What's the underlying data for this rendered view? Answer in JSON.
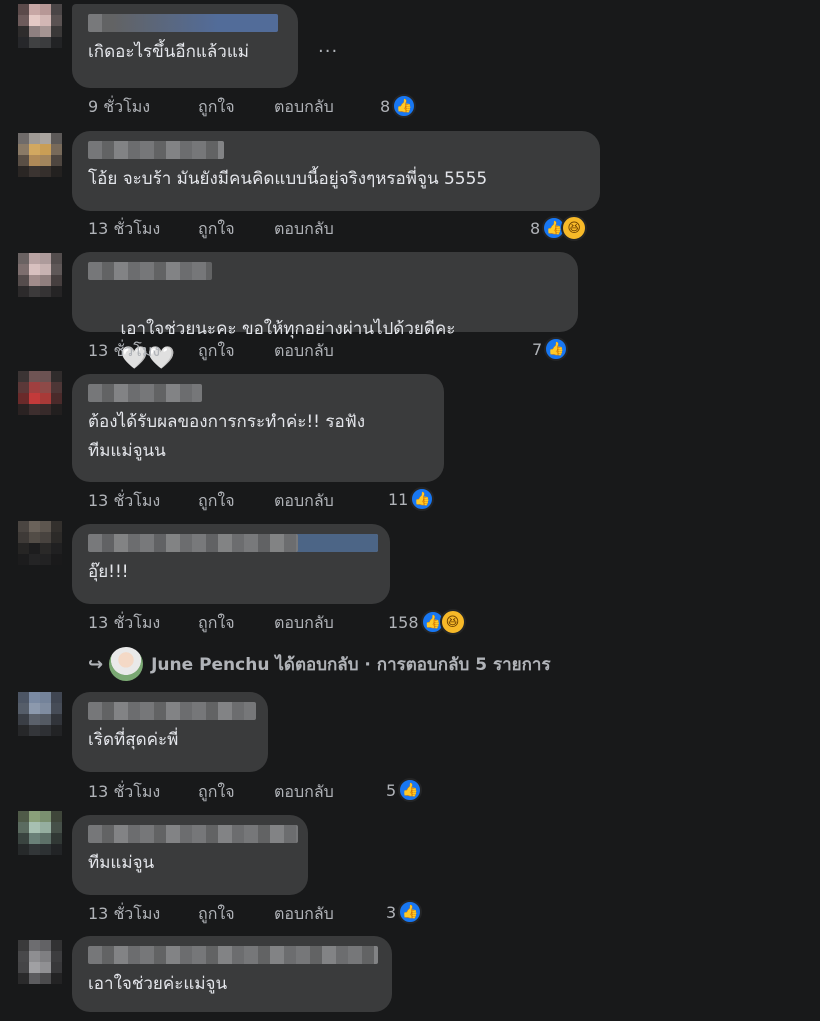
{
  "ui": {
    "more_label": "...",
    "like_glyph": "👍",
    "haha_glyph": "😆"
  },
  "comments": [
    {
      "text": "เกิดอะไรขึ้นอีกแล้วแม่",
      "time": "9 ชั่วโมง",
      "like": "ถูกใจ",
      "reply": "ตอบกลับ",
      "count": "8",
      "reactions": [
        "like"
      ]
    },
    {
      "text": "โอ้ย จะบร้า มันยังมีคนคิดแบบนี้อยู่จริงๆหรอพี่จูน 5555",
      "time": "13 ชั่วโมง",
      "like": "ถูกใจ",
      "reply": "ตอบกลับ",
      "count": "8",
      "reactions": [
        "like",
        "haha"
      ]
    },
    {
      "text": "เอาใจช่วยนะคะ ขอให้ทุกอย่างผ่านไปด้วยดีคะ",
      "hearts": "🤍🤍",
      "time": "13 ชั่วโมง",
      "like": "ถูกใจ",
      "reply": "ตอบกลับ",
      "count": "7",
      "reactions": [
        "like"
      ]
    },
    {
      "text": "ต้องได้รับผลของการกระทำค่ะ!! รอฟัง\nทีมแม่จูนน",
      "time": "13 ชั่วโมง",
      "like": "ถูกใจ",
      "reply": "ตอบกลับ",
      "count": "11",
      "reactions": [
        "like"
      ]
    },
    {
      "text": "อุ๊ย!!!",
      "time": "13 ชั่วโมง",
      "like": "ถูกใจ",
      "reply": "ตอบกลับ",
      "count": "158",
      "reactions": [
        "like",
        "haha"
      ]
    },
    {
      "text": "เริ่ดที่สุดค่ะพี่",
      "time": "13 ชั่วโมง",
      "like": "ถูกใจ",
      "reply": "ตอบกลับ",
      "count": "5",
      "reactions": [
        "like"
      ]
    },
    {
      "text": "ทีมแม่จูน",
      "time": "13 ชั่วโมง",
      "like": "ถูกใจ",
      "reply": "ตอบกลับ",
      "count": "3",
      "reactions": [
        "like"
      ]
    },
    {
      "text": "เอาใจช่วยค่ะแม่จูน"
    }
  ],
  "replies_link": {
    "arrow": "↪",
    "text": "June Penchu ได้ตอบกลับ · การตอบกลับ 5 รายการ"
  },
  "colors": {
    "background": "#18191a",
    "bubble": "#3a3b3c",
    "like_blue": "#1877f2",
    "haha_yellow": "#f7b928",
    "meta_text": "#b0b3b8"
  }
}
